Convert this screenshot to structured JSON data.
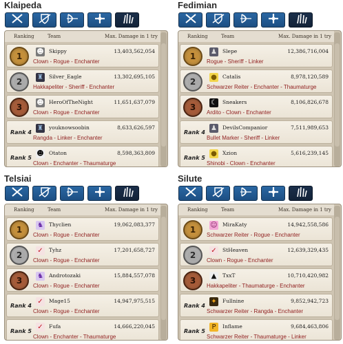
{
  "headers": {
    "ranking": "Ranking",
    "team": "Team",
    "max_damage": "Max. Damage in 1 try"
  },
  "tab_icons": [
    "crossed-swords-icon",
    "shield-sword-icon",
    "bow-icon",
    "cross-icon",
    "claw-icon"
  ],
  "colors": {
    "tab_blue": "#2a67a3",
    "tab_active": "#1b2f4a",
    "class_text": "#8f1d1d"
  },
  "panels": [
    {
      "title": "Klaipeda",
      "rows": [
        {
          "rank": "1",
          "rank_text": "",
          "emblem": "skull-emblem-icon",
          "player": "Skippy",
          "damage": "13,403,562,054",
          "classes": "Clown - Rogue - Enchanter"
        },
        {
          "rank": "2",
          "rank_text": "",
          "emblem": "dark-emblem-icon",
          "player": "Silver_Eagle",
          "damage": "13,302,695,105",
          "classes": "Hakkapeliter - Sheriff - Enchanter"
        },
        {
          "rank": "3",
          "rank_text": "",
          "emblem": "skull-emblem-icon",
          "player": "HeroOfTheNight",
          "damage": "11,651,637,079",
          "classes": "Clown - Rogue - Enchanter"
        },
        {
          "rank": "",
          "rank_text": "Rank 4",
          "emblem": "dark-emblem-icon",
          "player": "youknowsoobin",
          "damage": "8,633,626,597",
          "classes": "Rangda - Linker - Enchanter"
        },
        {
          "rank": "",
          "rank_text": "Rank 5",
          "emblem": "sunglasses-emblem-icon",
          "player": "Otaton",
          "damage": "8,598,363,809",
          "classes": "Clown - Enchanter - Thaumaturge"
        }
      ]
    },
    {
      "title": "Fedimian",
      "rows": [
        {
          "rank": "1",
          "rank_text": "",
          "emblem": "portrait-emblem-icon",
          "player": "Slepe",
          "damage": "12,386,716,004",
          "classes": "Rogue - Sheriff - Linker"
        },
        {
          "rank": "2",
          "rank_text": "",
          "emblem": "chick-emblem-icon",
          "player": "Catalis",
          "damage": "8,978,120,589",
          "classes": "Schwarzer Reiter - Enchanter - Thaumaturge"
        },
        {
          "rank": "3",
          "rank_text": "",
          "emblem": "moon-emblem-icon",
          "player": "Sneakers",
          "damage": "8,106,826,678",
          "classes": "Ardito - Clown - Enchanter"
        },
        {
          "rank": "",
          "rank_text": "Rank 4",
          "emblem": "portrait-emblem-icon",
          "player": "DevilsCompanior",
          "damage": "7,511,989,653",
          "classes": "Bullet Marker - Sheriff - Linker"
        },
        {
          "rank": "",
          "rank_text": "Rank 5",
          "emblem": "chick-emblem-icon",
          "player": "Xzion",
          "damage": "5,616,239,145",
          "classes": "Shinobi - Clown - Enchanter"
        }
      ]
    },
    {
      "title": "Telsiai",
      "rows": [
        {
          "rank": "1",
          "rank_text": "",
          "emblem": "purple-figure-emblem-icon",
          "player": "Thyclien",
          "damage": "19,062,083,377",
          "classes": "Clown - Rogue - Enchanter"
        },
        {
          "rank": "2",
          "rank_text": "",
          "emblem": "red-bird-emblem-icon",
          "player": "Tyhz",
          "damage": "17,201,658,727",
          "classes": "Clown - Rogue - Enchanter"
        },
        {
          "rank": "3",
          "rank_text": "",
          "emblem": "purple-figure-emblem-icon",
          "player": "Androtozaki",
          "damage": "15,884,557,078",
          "classes": "Clown - Rogue - Enchanter"
        },
        {
          "rank": "",
          "rank_text": "Rank 4",
          "emblem": "red-bird-emblem-icon",
          "player": "Mage15",
          "damage": "14,947,975,515",
          "classes": "Clown - Rogue - Enchanter"
        },
        {
          "rank": "",
          "rank_text": "Rank 5",
          "emblem": "red-bird-emblem-icon",
          "player": "Fufa",
          "damage": "14,666,220,045",
          "classes": "Clown - Enchanter - Thaumaturge"
        }
      ]
    },
    {
      "title": "Silute",
      "rows": [
        {
          "rank": "1",
          "rank_text": "",
          "emblem": "pink-face-emblem-icon",
          "player": "MiraKaty",
          "damage": "14,942,558,586",
          "classes": "Schwarzer Reiter - Rogue - Enchanter"
        },
        {
          "rank": "2",
          "rank_text": "",
          "emblem": "red-bird-emblem-icon",
          "player": "StHeaven",
          "damage": "12,639,329,435",
          "classes": "Clown - Rogue - Enchanter"
        },
        {
          "rank": "3",
          "rank_text": "",
          "emblem": "hat-emblem-icon",
          "player": "TxxT",
          "damage": "10,710,420,982",
          "classes": "Hakkapeliter - Thaumaturge - Enchanter"
        },
        {
          "rank": "",
          "rank_text": "Rank 4",
          "emblem": "fire-emblem-icon",
          "player": "Fullnine",
          "damage": "9,852,942,723",
          "classes": "Schwarzer Reiter - Rangda - Enchanter"
        },
        {
          "rank": "",
          "rank_text": "Rank 5",
          "emblem": "p-badge-emblem-icon",
          "player": "Inflame",
          "damage": "9,684,463,806",
          "classes": "Schwarzer Reiter - Thaumaturge - Linker"
        }
      ]
    }
  ]
}
